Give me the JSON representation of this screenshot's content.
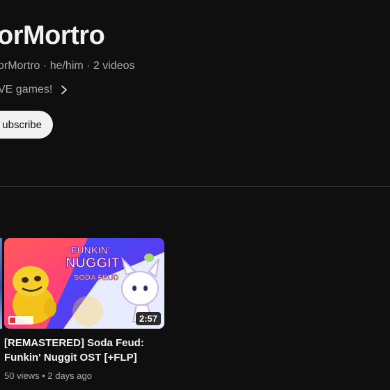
{
  "channel": {
    "name": "orMortro",
    "handle": "orMortro",
    "pronouns": "he/him",
    "video_count": "2 videos",
    "description": "VE games!",
    "subscribe_label": "ubscribe"
  },
  "videos": [
    {
      "title": "[REMASTERED] Soda Feud: Funkin' Nuggit OST [+FLP]",
      "views": "50 views",
      "age": "2 days ago",
      "duration": "2:57",
      "thumbnail_art_text": {
        "line1": "FUNKIN'",
        "line2": "NUGGIT",
        "line3": "SODA FEUD"
      }
    }
  ],
  "colors": {
    "background": "#0f0f0f",
    "text_primary": "#f1f1f1",
    "text_secondary": "#aaaaaa",
    "subscribe_bg": "#f1f1f1",
    "divider": "#3f3f3f"
  },
  "icons": {
    "description_more": "chevron-right-icon"
  }
}
